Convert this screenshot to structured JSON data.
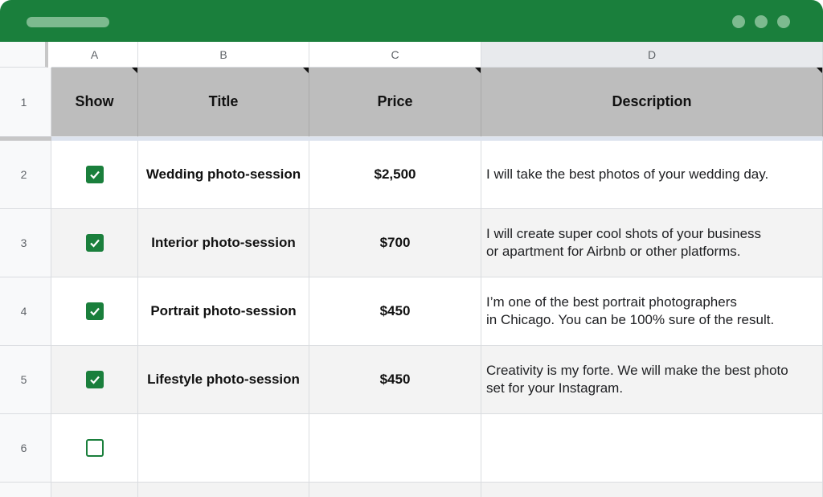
{
  "columns": [
    "A",
    "B",
    "C",
    "D"
  ],
  "rows": [
    "1",
    "2",
    "3",
    "4",
    "5",
    "6"
  ],
  "header": {
    "show": "Show",
    "title": "Title",
    "price": "Price",
    "description": "Description"
  },
  "items": [
    {
      "checked": true,
      "title": "Wedding photo-session",
      "price": "$2,500",
      "desc_line1": "I will take the best photos of your wedding day.",
      "desc_line2": ""
    },
    {
      "checked": true,
      "title": "Interior photo-session",
      "price": "$700",
      "desc_line1": "I will create super cool shots of your business",
      "desc_line2": "or apartment for Airbnb or other platforms."
    },
    {
      "checked": true,
      "title": "Portrait photo-session",
      "price": "$450",
      "desc_line1": "I’m one of the best portrait photographers",
      "desc_line2": "in Chicago. You can be 100% sure of the result."
    },
    {
      "checked": true,
      "title": "Lifestyle photo-session",
      "price": "$450",
      "desc_line1": "Creativity is my forte. We will make the best photo",
      "desc_line2": "set for your Instagram."
    },
    {
      "checked": false,
      "title": "",
      "price": "",
      "desc_line1": "",
      "desc_line2": ""
    }
  ],
  "colors": {
    "brand": "#1a7f3c",
    "header_fill": "#bdbdbd",
    "alt_row": "#f3f3f3"
  }
}
